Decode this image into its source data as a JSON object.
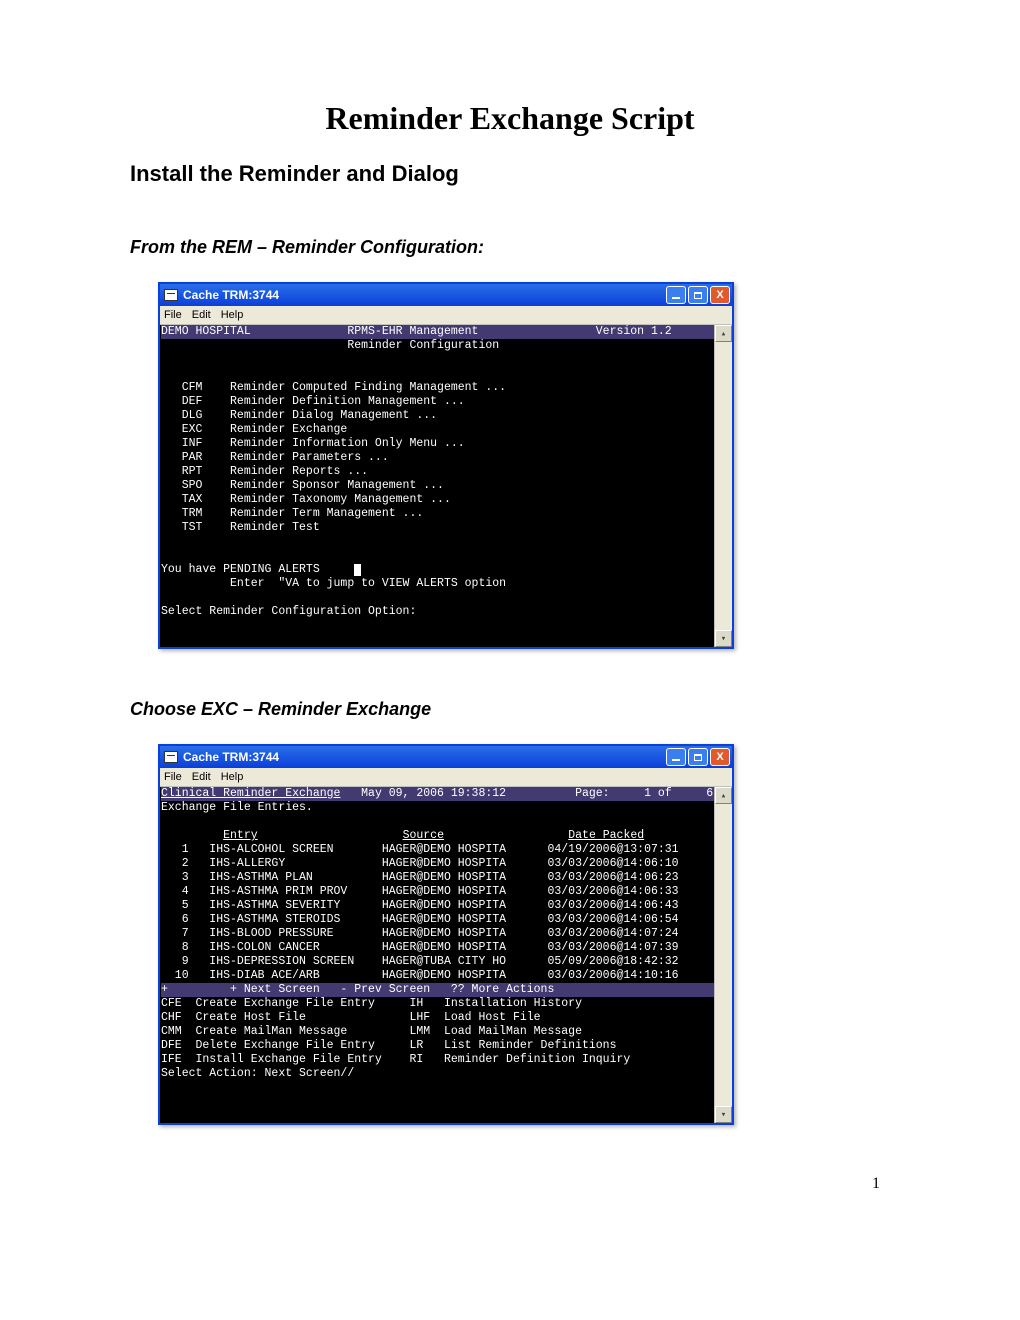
{
  "doc": {
    "title": "Reminder Exchange Script",
    "section": "Install the Reminder and Dialog",
    "step1": "From the REM – Reminder Configuration:",
    "step2": "Choose  EXC – Reminder Exchange",
    "page_number": "1"
  },
  "win_common": {
    "title": "Cache TRM:3744",
    "menu_file": "File",
    "menu_edit": "Edit",
    "menu_help": "Help"
  },
  "term1": {
    "header_left": "DEMO HOSPITAL",
    "header_center": "RPMS-EHR Management",
    "header_right": "Version 1.2",
    "subhead": "Reminder Configuration",
    "menu": [
      {
        "code": "CFM",
        "label": "Reminder Computed Finding Management ..."
      },
      {
        "code": "DEF",
        "label": "Reminder Definition Management ..."
      },
      {
        "code": "DLG",
        "label": "Reminder Dialog Management ..."
      },
      {
        "code": "EXC",
        "label": "Reminder Exchange"
      },
      {
        "code": "INF",
        "label": "Reminder Information Only Menu ..."
      },
      {
        "code": "PAR",
        "label": "Reminder Parameters ..."
      },
      {
        "code": "RPT",
        "label": "Reminder Reports ..."
      },
      {
        "code": "SPO",
        "label": "Reminder Sponsor Management ..."
      },
      {
        "code": "TAX",
        "label": "Reminder Taxonomy Management ..."
      },
      {
        "code": "TRM",
        "label": "Reminder Term Management ..."
      },
      {
        "code": "TST",
        "label": "Reminder Test"
      }
    ],
    "alerts": "You have PENDING ALERTS",
    "alerts_hint": "Enter  \"VA to jump to VIEW ALERTS option",
    "prompt": "Select Reminder Configuration Option:"
  },
  "term2": {
    "header_left": "Clinical Reminder Exchange",
    "header_date": "May 09, 2006 19:38:12",
    "header_page_label": "Page:",
    "header_page": "1 of",
    "header_total": "6",
    "sub": "Exchange File Entries.",
    "cols": {
      "entry": "Entry",
      "source": "Source",
      "date": "Date Packed"
    },
    "rows": [
      {
        "n": "1",
        "entry": "IHS-ALCOHOL SCREEN",
        "source": "HAGER@DEMO HOSPITA",
        "date": "04/19/2006@13:07:31"
      },
      {
        "n": "2",
        "entry": "IHS-ALLERGY",
        "source": "HAGER@DEMO HOSPITA",
        "date": "03/03/2006@14:06:10"
      },
      {
        "n": "3",
        "entry": "IHS-ASTHMA PLAN",
        "source": "HAGER@DEMO HOSPITA",
        "date": "03/03/2006@14:06:23"
      },
      {
        "n": "4",
        "entry": "IHS-ASTHMA PRIM PROV",
        "source": "HAGER@DEMO HOSPITA",
        "date": "03/03/2006@14:06:33"
      },
      {
        "n": "5",
        "entry": "IHS-ASTHMA SEVERITY",
        "source": "HAGER@DEMO HOSPITA",
        "date": "03/03/2006@14:06:43"
      },
      {
        "n": "6",
        "entry": "IHS-ASTHMA STEROIDS",
        "source": "HAGER@DEMO HOSPITA",
        "date": "03/03/2006@14:06:54"
      },
      {
        "n": "7",
        "entry": "IHS-BLOOD PRESSURE",
        "source": "HAGER@DEMO HOSPITA",
        "date": "03/03/2006@14:07:24"
      },
      {
        "n": "8",
        "entry": "IHS-COLON CANCER",
        "source": "HAGER@DEMO HOSPITA",
        "date": "03/03/2006@14:07:39"
      },
      {
        "n": "9",
        "entry": "IHS-DEPRESSION SCREEN",
        "source": "HAGER@TUBA CITY HO",
        "date": "05/09/2006@18:42:32"
      },
      {
        "n": "10",
        "entry": "IHS-DIAB ACE/ARB",
        "source": "HAGER@DEMO HOSPITA",
        "date": "03/03/2006@14:10:16"
      }
    ],
    "navbar": {
      "plus": "+",
      "next": "+ Next Screen",
      "prev": "- Prev Screen",
      "more": "?? More Actions"
    },
    "actions": [
      {
        "lc": "CFE",
        "ll": "Create Exchange File Entry",
        "rc": "IH",
        "rl": "Installation History"
      },
      {
        "lc": "CHF",
        "ll": "Create Host File",
        "rc": "LHF",
        "rl": "Load Host File"
      },
      {
        "lc": "CMM",
        "ll": "Create MailMan Message",
        "rc": "LMM",
        "rl": "Load MailMan Message"
      },
      {
        "lc": "DFE",
        "ll": "Delete Exchange File Entry",
        "rc": "LR",
        "rl": "List Reminder Definitions"
      },
      {
        "lc": "IFE",
        "ll": "Install Exchange File Entry",
        "rc": "RI",
        "rl": "Reminder Definition Inquiry"
      }
    ],
    "prompt": "Select Action: Next Screen//"
  }
}
